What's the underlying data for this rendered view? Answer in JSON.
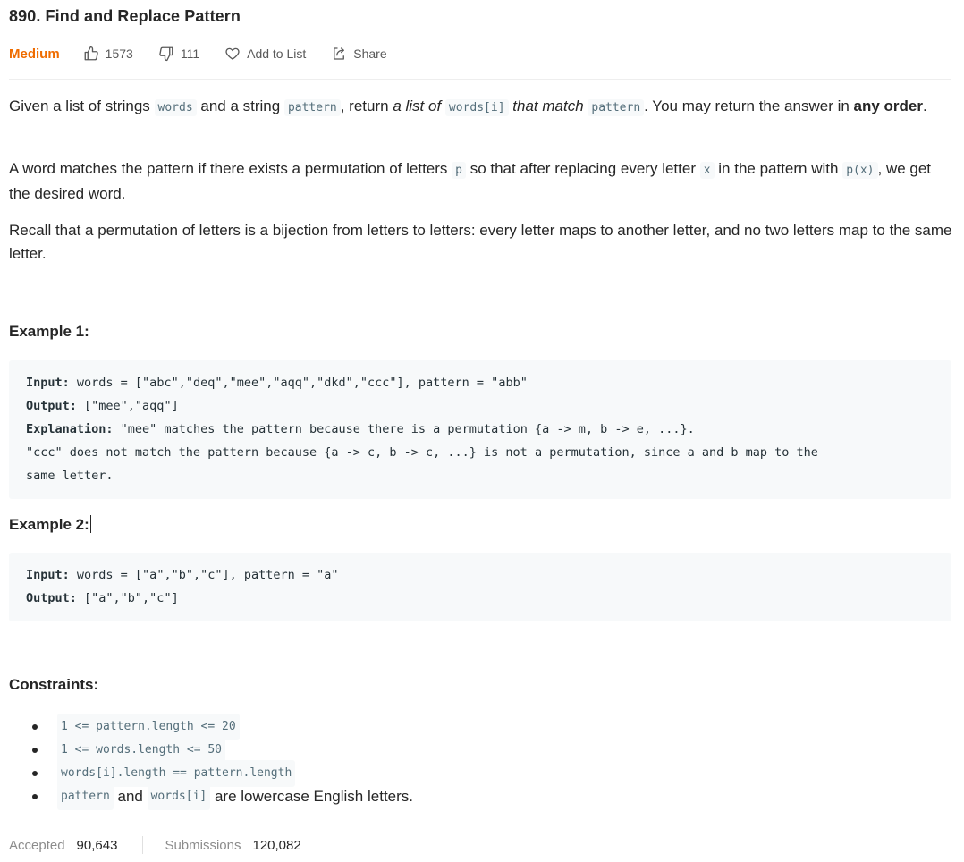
{
  "problem": {
    "title": "890. Find and Replace Pattern",
    "difficulty": "Medium",
    "likes": "1573",
    "dislikes": "111",
    "add_to_list": "Add to List",
    "share": "Share"
  },
  "description": {
    "p1": {
      "t1": "Given a list of strings ",
      "c1": "words",
      "t2": " and a string ",
      "c2": "pattern",
      "t3": ", return ",
      "i1": "a list of ",
      "c3": "words[i]",
      "i2": " that match ",
      "c4": "pattern",
      "t4": ". You may return the answer in ",
      "b1": "any order",
      "t5": "."
    },
    "p2": {
      "t1": "A word matches the pattern if there exists a permutation of letters ",
      "c1": "p",
      "t2": " so that after replacing every letter ",
      "c2": "x",
      "t3": " in the pattern with ",
      "c3": "p(x)",
      "t4": ", we get the desired word."
    },
    "p3": "Recall that a permutation of letters is a bijection from letters to letters: every letter maps to another letter, and no two letters map to the same letter."
  },
  "example1": {
    "heading": "Example 1:",
    "input_label": "Input:",
    "input_value": " words = [\"abc\",\"deq\",\"mee\",\"aqq\",\"dkd\",\"ccc\"], pattern = \"abb\"",
    "output_label": "Output:",
    "output_value": " [\"mee\",\"aqq\"]",
    "explanation_label": "Explanation:",
    "explanation_line1": " \"mee\" matches the pattern because there is a permutation {a -> m, b -> e, ...}.",
    "explanation_line2": "\"ccc\" does not match the pattern because {a -> c, b -> c, ...} is not a permutation, since a and b map to the",
    "explanation_line3": "same letter."
  },
  "example2": {
    "heading": "Example 2:",
    "input_label": "Input:",
    "input_value": " words = [\"a\",\"b\",\"c\"], pattern = \"a\"",
    "output_label": "Output:",
    "output_value": " [\"a\",\"b\",\"c\"]"
  },
  "constraints": {
    "heading": "Constraints:",
    "items": [
      "1 <= pattern.length <= 20",
      "1 <= words.length <= 50",
      "words[i].length == pattern.length"
    ],
    "last": {
      "c1": "pattern",
      "t1": " and ",
      "c2": "words[i]",
      "t2": " are lowercase English letters."
    }
  },
  "stats": {
    "accepted_label": "Accepted",
    "accepted_value": "90,643",
    "submissions_label": "Submissions",
    "submissions_value": "120,082"
  },
  "colors": {
    "difficulty_medium": "#ef6c00",
    "code_bg": "#f7f9fa",
    "inline_code_text": "#546e7a"
  },
  "icons": [
    "thumbs-up-icon",
    "thumbs-down-icon",
    "heart-icon",
    "share-icon"
  ]
}
